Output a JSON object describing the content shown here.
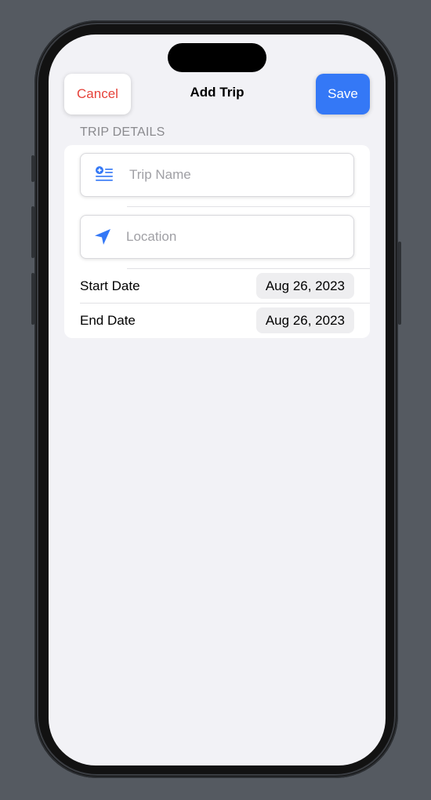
{
  "nav": {
    "cancel_label": "Cancel",
    "title": "Add Trip",
    "save_label": "Save"
  },
  "section": {
    "header": "TRIP DETAILS"
  },
  "fields": {
    "trip_name": {
      "placeholder": "Trip Name",
      "value": "",
      "icon": "text-badge-plus-icon"
    },
    "location": {
      "placeholder": "Location",
      "value": "",
      "icon": "location-arrow-icon"
    }
  },
  "dates": {
    "start": {
      "label": "Start Date",
      "value": "Aug 26, 2023"
    },
    "end": {
      "label": "End Date",
      "value": "Aug 26, 2023"
    }
  },
  "colors": {
    "accent": "#3478f6",
    "destructive": "#e6423a",
    "background": "#f2f2f6",
    "card": "#ffffff"
  }
}
